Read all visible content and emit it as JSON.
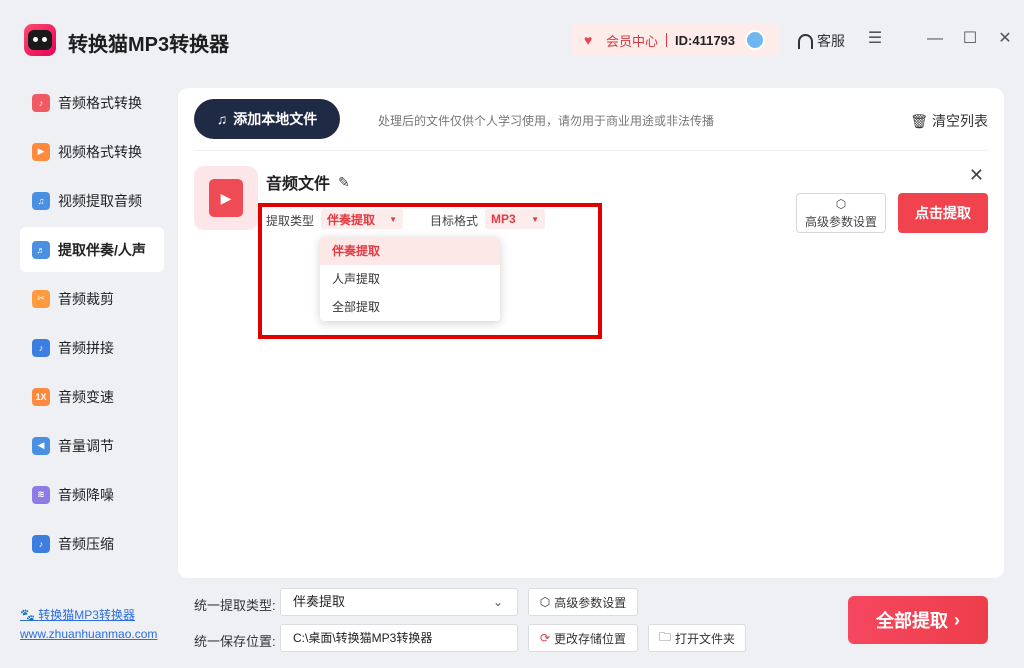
{
  "app": {
    "title": "转换猫MP3转换器",
    "member_label": "会员中心",
    "user_id": "ID:411793",
    "service_label": "客服"
  },
  "sidebar": {
    "items": [
      {
        "label": "音频格式转换",
        "icon": "audio-format-icon",
        "color": "#ef5a63"
      },
      {
        "label": "视频格式转换",
        "icon": "video-format-icon",
        "color": "#ff8a3d"
      },
      {
        "label": "视频提取音频",
        "icon": "video-extract-icon",
        "color": "#4a90e2"
      },
      {
        "label": "提取伴奏/人声",
        "icon": "vocal-extract-icon",
        "color": "#4a90e2"
      },
      {
        "label": "音频裁剪",
        "icon": "audio-cut-icon",
        "color": "#ff9b3d"
      },
      {
        "label": "音频拼接",
        "icon": "audio-join-icon",
        "color": "#3d7fe0"
      },
      {
        "label": "音频变速",
        "icon": "audio-speed-icon",
        "color": "#ff8a3d"
      },
      {
        "label": "音量调节",
        "icon": "volume-icon",
        "color": "#4a90e2"
      },
      {
        "label": "音频降噪",
        "icon": "denoise-icon",
        "color": "#8e7be6"
      },
      {
        "label": "音频压缩",
        "icon": "compress-icon",
        "color": "#3d7fe0"
      }
    ],
    "speed_badge": "1X",
    "footer_brand": "转换猫MP3转换器",
    "footer_url": "www.zhuanhuanmao.com"
  },
  "main": {
    "add_file_label": "添加本地文件",
    "notice": "处理后的文件仅供个人学习使用，请勿用于商业用途或非法传播",
    "clear_label": "清空列表",
    "file": {
      "name": "音频文件",
      "extract_type_label": "提取类型",
      "extract_type_value": "伴奏提取",
      "target_format_label": "目标格式",
      "target_format_value": "MP3",
      "advanced_label": "高级参数设置",
      "extract_button": "点击提取"
    },
    "dropdown_options": [
      "伴奏提取",
      "人声提取",
      "全部提取"
    ]
  },
  "bottom": {
    "unified_type_label": "统一提取类型:",
    "unified_type_value": "伴奏提取",
    "advanced_label": "高级参数设置",
    "save_path_label": "统一保存位置:",
    "save_path_value": "C:\\桌面\\转换猫MP3转换器",
    "change_path_label": "更改存储位置",
    "open_folder_label": "打开文件夹",
    "extract_all_label": "全部提取"
  },
  "colors": {
    "accent": "#f0434d",
    "dark_button": "#1f2a44",
    "highlight": "#e00000"
  }
}
